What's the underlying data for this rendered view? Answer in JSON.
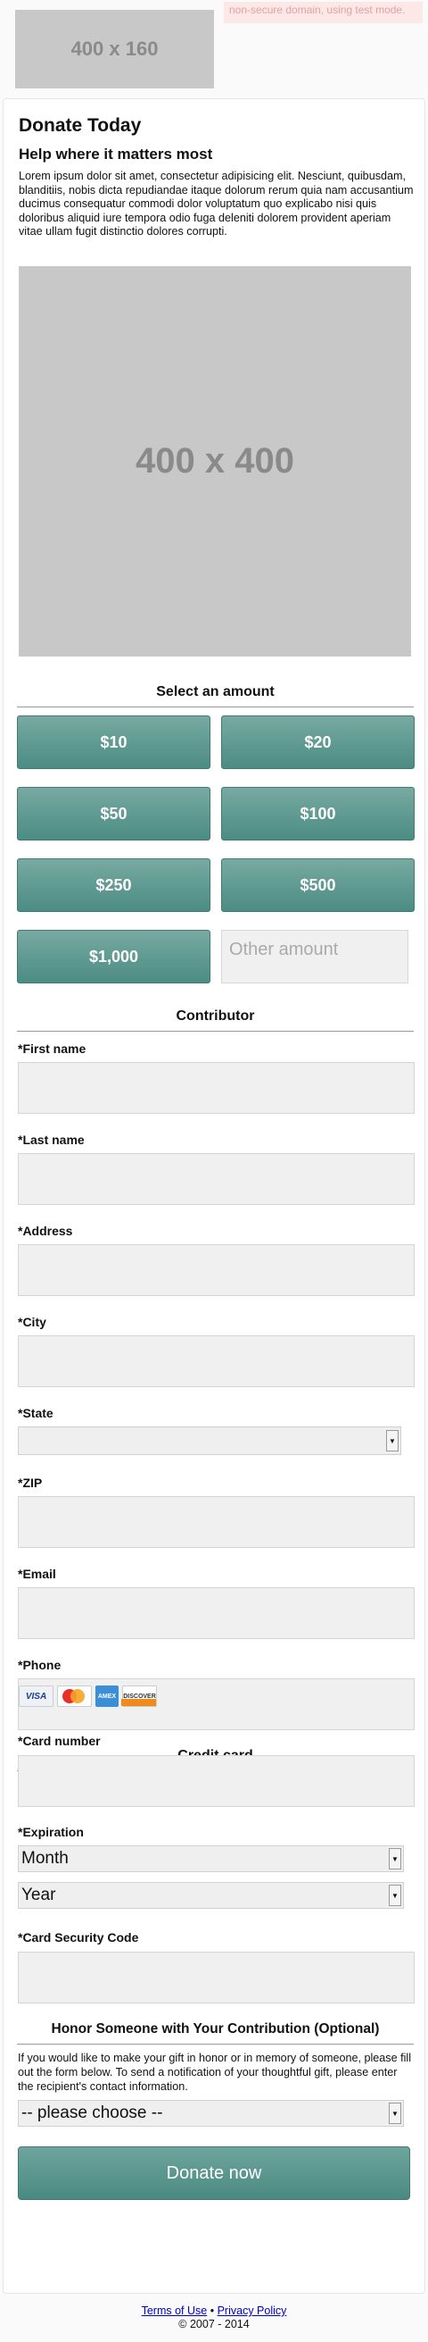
{
  "header": {
    "logo_placeholder": "400 x 160",
    "notice": "non-secure domain, using test mode."
  },
  "intro": {
    "title": "Donate Today",
    "subtitle": "Help where it matters most",
    "body": "Lorem ipsum dolor sit amet, consectetur adipisicing elit. Nesciunt, quibusdam, blanditiis, nobis dicta repudiandae itaque dolorum rerum quia nam accusantium ducimus consequatur commodi dolor voluptatum quo explicabo nisi quis doloribus aliquid iure tempora odio fuga deleniti dolorem provident aperiam vitae ullam fugit distinctio dolores corrupti.",
    "image_placeholder": "400 x 400"
  },
  "amount": {
    "heading": "Select an amount",
    "options": [
      "$10",
      "$20",
      "$50",
      "$100",
      "$250",
      "$500",
      "$1,000"
    ],
    "other_placeholder": "Other amount"
  },
  "contributor": {
    "heading": "Contributor",
    "fields": {
      "first_name": "*First name",
      "last_name": "*Last name",
      "address": "*Address",
      "city": "*City",
      "state": "*State",
      "zip": "*ZIP",
      "email": "*Email",
      "phone": "*Phone"
    },
    "state_selected": ""
  },
  "credit_card": {
    "heading": "Credit card",
    "cards": [
      "visa-icon",
      "mastercard-icon",
      "amex-icon",
      "discover-icon"
    ],
    "card_labels": {
      "visa": "VISA",
      "amex": "AMEX",
      "discover": "DISCOVER"
    },
    "card_number_label": "*Card number",
    "expiration_label": "*Expiration",
    "month_selected": "Month",
    "year_selected": "Year",
    "security_code_label": "*Card Security Code"
  },
  "honor": {
    "heading": "Honor Someone with Your Contribution (Optional)",
    "body": "If you would like to make your gift in honor or in memory of someone, please fill out the form below. To send a notification of your thoughtful gift, please enter the recipient's contact information.",
    "select_selected": "-- please choose --"
  },
  "submit": {
    "label": "Donate now"
  },
  "footer": {
    "terms": "Terms of Use",
    "separator": "•",
    "privacy": "Privacy Policy",
    "copyright": "© 2007 - 2014"
  },
  "colors": {
    "button_teal": "#5b9a92",
    "notice_bg": "#fde8e8",
    "notice_text": "#e5a0a0",
    "link": "#0000cc"
  }
}
